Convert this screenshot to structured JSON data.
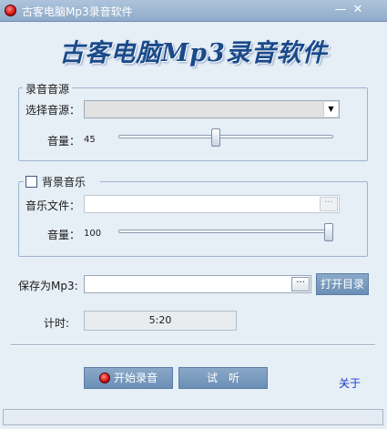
{
  "window": {
    "title": "古客电脑Mp3录音软件",
    "minimize_glyph": "—",
    "close_glyph": "✕"
  },
  "banner": {
    "text": "古客电脑Mp3录音软件"
  },
  "source_group": {
    "legend": "录音音源",
    "select_label": "选择音源：",
    "select_value": "",
    "volume_label": "音量：",
    "volume_value": "45",
    "volume_level": 45
  },
  "music_group": {
    "legend": "背景音乐",
    "checked": false,
    "file_label": "音乐文件：",
    "file_value": "",
    "browse_glyph": "···",
    "volume_label": "音量：",
    "volume_value": "100",
    "volume_level": 100
  },
  "save": {
    "label": "保存为Mp3:",
    "value": "",
    "browse_glyph": "···",
    "open_dir_label": "打开目录"
  },
  "timer": {
    "label": "计时:",
    "value": "5:20"
  },
  "actions": {
    "start_label": "开始录音",
    "listen_label": "试　听",
    "about_label": "关于"
  },
  "colors": {
    "banner_text": "#1a4a8a",
    "button_bg": "#7b9cc0",
    "link": "#1a3cc8",
    "record_red": "#d01010"
  },
  "icons": {
    "app": "record-dot-icon",
    "dropdown": "chevron-down-icon",
    "browse": "ellipsis-icon"
  }
}
